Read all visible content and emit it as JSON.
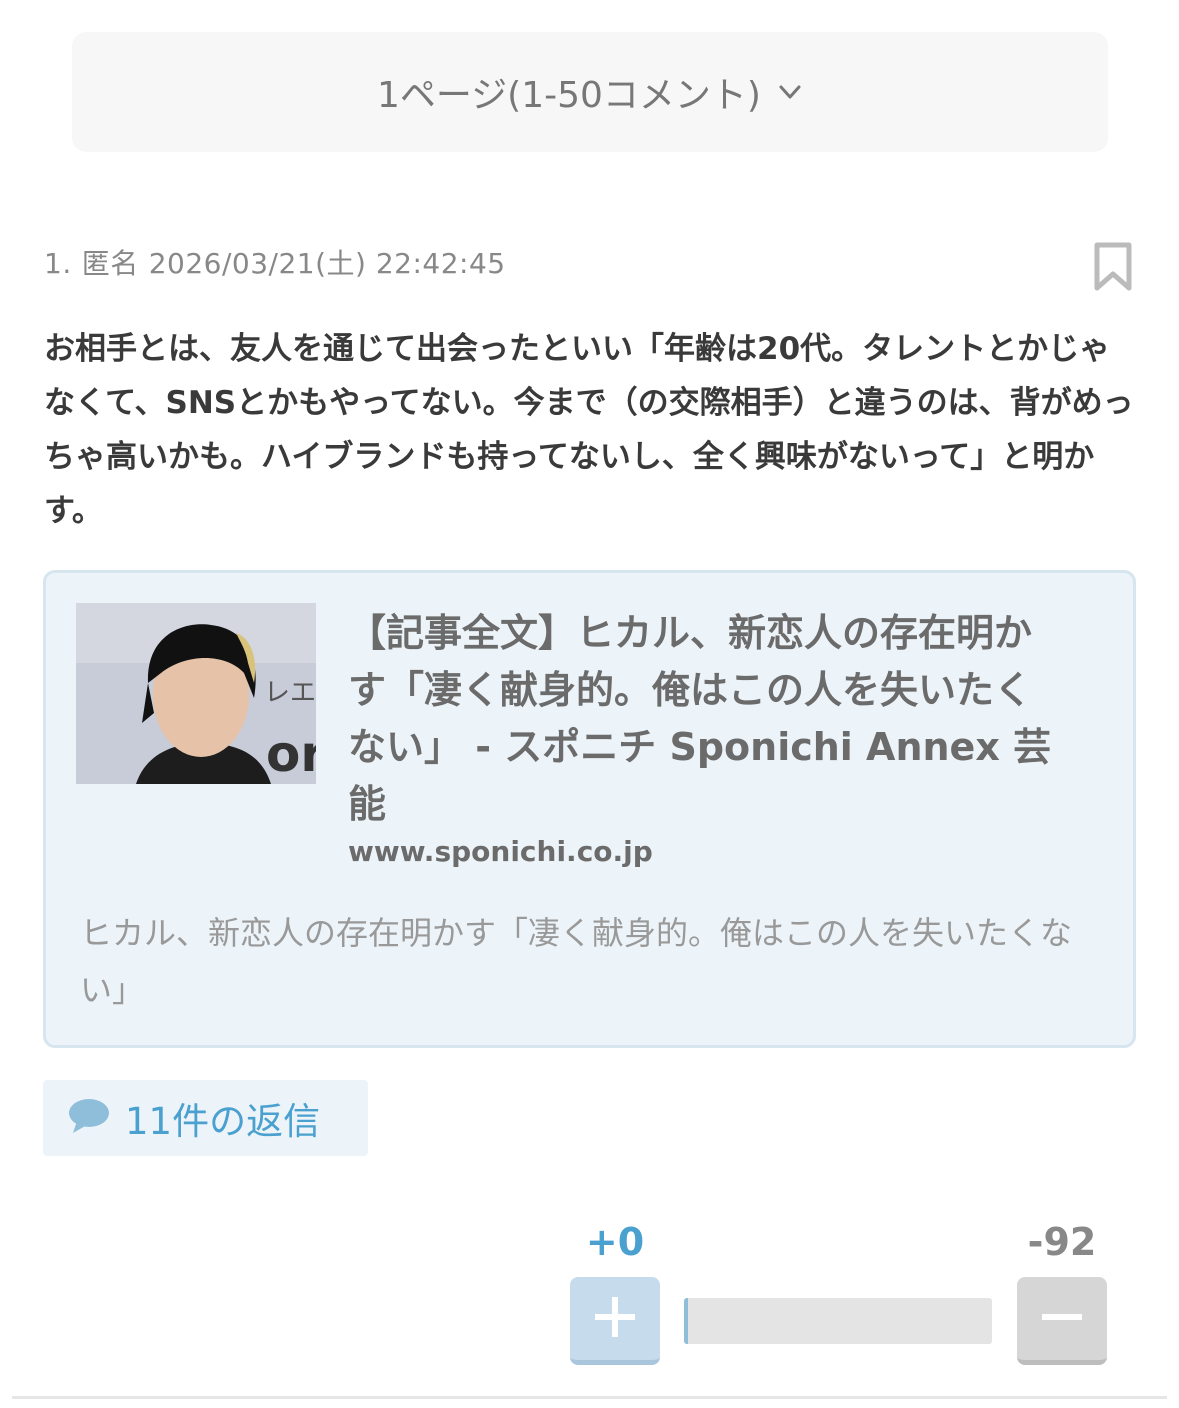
{
  "pagination": {
    "label": "1ページ(1-50コメント)",
    "icon": "chevron-down-icon"
  },
  "comment": {
    "number": "1.",
    "author": "匿名",
    "timestamp": "2026/03/21(土) 22:42:45",
    "body": "お相手とは、友人を通じて出会ったといい「年齢は20代。タレントとかじゃなくて、SNSとかもやってない。今まで（の交際相手）と違うのは、背がめっちゃ高いかも。ハイブランドも持ってないし、全く興味がないって」と明かす。",
    "bookmark_icon": "bookmark-icon"
  },
  "link_card": {
    "title": "【記事全文】ヒカル、新恋人の存在明かす「凄く献身的。俺はこの人を失いたくない」 - スポニチ Sponichi Annex 芸能",
    "domain": "www.sponichi.co.jp",
    "description": "ヒカル、新恋人の存在明かす「凄く献身的。俺はこの人を失いたくない」",
    "thumbnail_text": "orid"
  },
  "replies": {
    "label": "11件の返信",
    "icon": "speech-bubble-icon"
  },
  "votes": {
    "plus": "+0",
    "minus": "-92",
    "plus_ratio": 0.0,
    "colors": {
      "plus": "#4aa0cf",
      "minus": "#888888"
    }
  }
}
